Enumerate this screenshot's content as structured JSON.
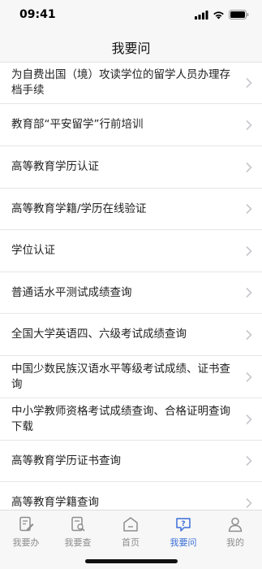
{
  "status_bar": {
    "time": "09:41"
  },
  "header": {
    "title": "我要问"
  },
  "list": {
    "items": [
      {
        "label": "为自费出国（境）攻读学位的留学人员办理存档手续"
      },
      {
        "label": "教育部“平安留学”行前培训"
      },
      {
        "label": "高等教育学历认证"
      },
      {
        "label": "高等教育学籍/学历在线验证"
      },
      {
        "label": "学位认证"
      },
      {
        "label": "普通话水平测试成绩查询"
      },
      {
        "label": "全国大学英语四、六级考试成绩查询"
      },
      {
        "label": "中国少数民族汉语水平等级考试成绩、证书查询"
      },
      {
        "label": "中小学教师资格考试成绩查询、合格证明查询下载"
      },
      {
        "label": "高等教育学历证书查询"
      },
      {
        "label": "高等教育学籍查询"
      }
    ]
  },
  "tab_bar": {
    "tabs": [
      {
        "label": "我要办",
        "icon": "edit-doc-icon"
      },
      {
        "label": "我要查",
        "icon": "search-doc-icon"
      },
      {
        "label": "首页",
        "icon": "home-icon"
      },
      {
        "label": "我要问",
        "icon": "question-chat-icon",
        "active": true
      },
      {
        "label": "我的",
        "icon": "person-icon"
      }
    ],
    "active_color": "#3b6fd8",
    "inactive_color": "#8e8e8e"
  }
}
